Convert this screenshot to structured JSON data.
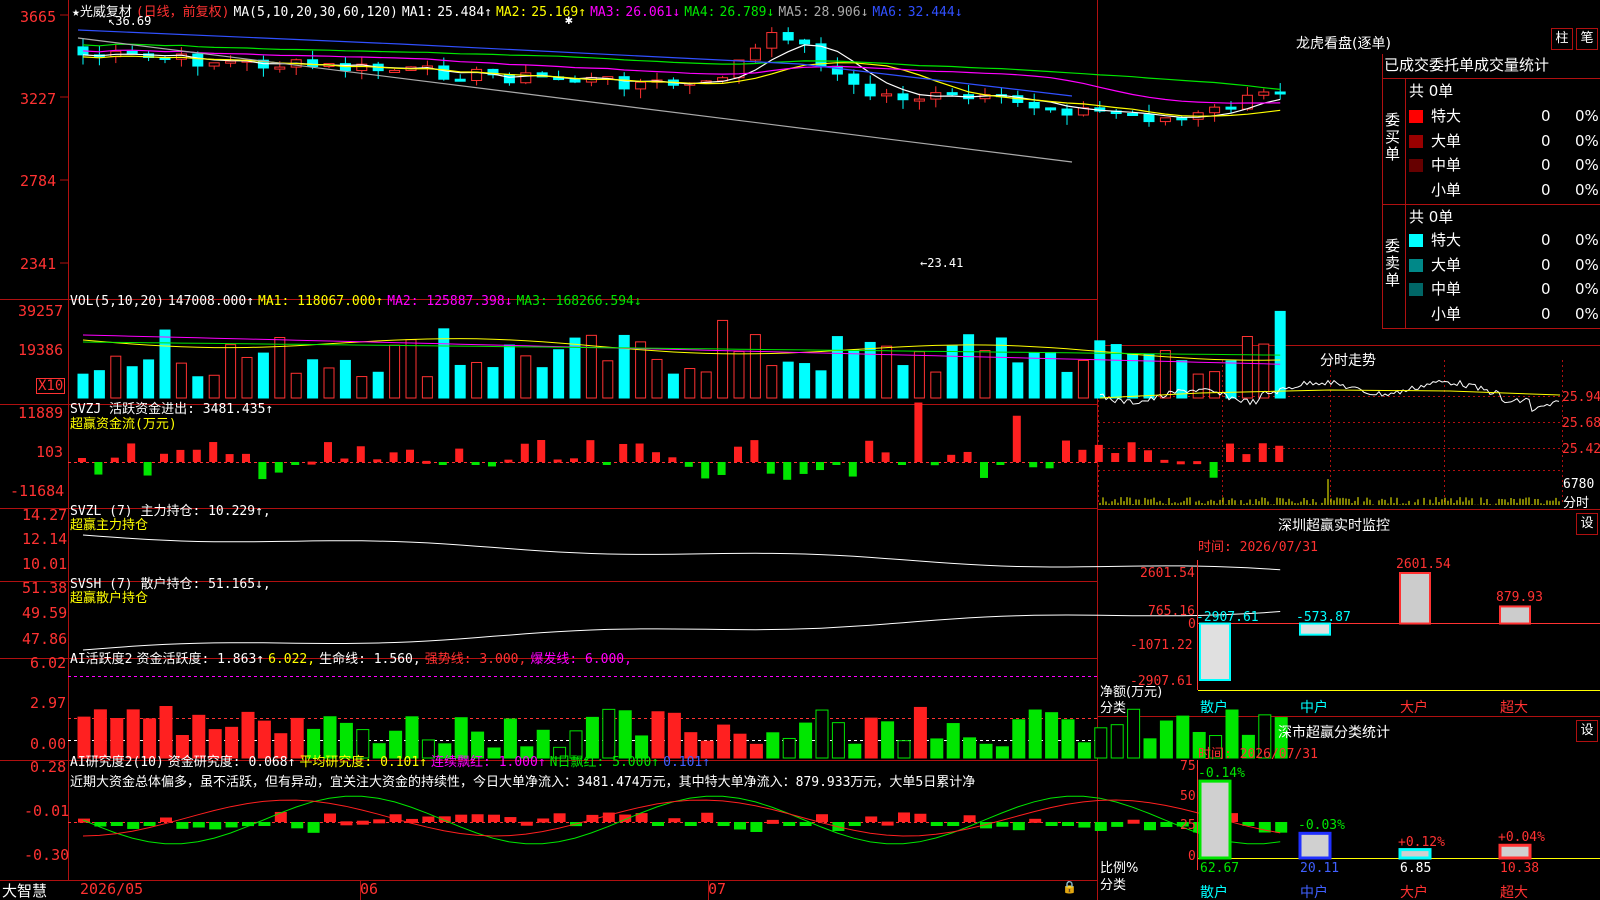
{
  "app": {
    "brand": "大智慧"
  },
  "main": {
    "star": "★",
    "stock": "光威复材",
    "period": "(日线，前复权)",
    "ma_header": "MA(5,10,20,30,60,120)",
    "ma": [
      {
        "label": "MA1:",
        "val": "25.484↑",
        "color": "#ffffff"
      },
      {
        "label": "MA2:",
        "val": "25.169↑",
        "color": "#ffff00"
      },
      {
        "label": "MA3:",
        "val": "26.061↓",
        "color": "#ff00ff"
      },
      {
        "label": "MA4:",
        "val": "26.789↓",
        "color": "#00e600"
      },
      {
        "label": "MA5:",
        "val": "28.906↓",
        "color": "#aaaaaa"
      },
      {
        "label": "MA6:",
        "val": "32.444↓",
        "color": "#3050ff"
      }
    ],
    "y_ticks": [
      "3665",
      "3227",
      "2784",
      "2341"
    ],
    "high_mark": "36.69",
    "low_mark": "←23.41",
    "snow": "✱"
  },
  "vol": {
    "header": "VOL(5,10,20)",
    "value": "147008.000↑",
    "ma1": "MA1: 118067.000↑",
    "ma2": "MA2: 125887.398↓",
    "ma3": "MA3: 168266.594↓",
    "y_ticks": [
      "39257",
      "19386"
    ],
    "unit": "X10"
  },
  "svzj": {
    "title": "SVZJ",
    "label": "活跃资金进出: 3481.435↑",
    "sub": "超赢资金流(万元)",
    "y_ticks": [
      "11889",
      "103",
      "-11684"
    ]
  },
  "svzl": {
    "title": "SVZL (7)",
    "label": "主力持仓: 10.229↑,",
    "sub": "超赢主力持仓",
    "y_ticks": [
      "14.27",
      "12.14",
      "10.01"
    ]
  },
  "svsh": {
    "title": "SVSH (7)",
    "label": "散户持仓: 51.165↓,",
    "sub": "超赢散户持仓",
    "y_ticks": [
      "51.38",
      "49.59",
      "47.86"
    ]
  },
  "ai1": {
    "title": "AI活跃度2",
    "parts": [
      {
        "t": "资金活跃度: 1.863↑",
        "c": "#ffffff"
      },
      {
        "t": "6.022,",
        "c": "#ffff00"
      },
      {
        "t": "生命线: 1.560,",
        "c": "#ffffff"
      },
      {
        "t": "强势线: 3.000,",
        "c": "#ff3232"
      },
      {
        "t": "爆发线: 6.000,",
        "c": "#ff00ff"
      }
    ],
    "y_ticks": [
      "6.02",
      "2.97",
      "0.00"
    ]
  },
  "ai2": {
    "title": "AI研究度2(10)",
    "parts": [
      {
        "t": "资金研究度: 0.068↑",
        "c": "#ffffff"
      },
      {
        "t": "平均研究度: 0.101↑",
        "c": "#ffff00"
      },
      {
        "t": "连续飘红: 1.000↑",
        "c": "#ff00ff"
      },
      {
        "t": "N日飘红: 5.000↑",
        "c": "#00e600"
      },
      {
        "t": "0.101↑",
        "c": "#4060ff"
      }
    ],
    "comment": "近期大资金总体偏多，虽不活跃，但有异动，宜关注大资金的持续性，今日大单净流入：3481.474万元，其中特大单净流入：879.933万元，大单5日累计净",
    "y_ticks": [
      "0.28",
      "-0.01",
      "-0.30"
    ]
  },
  "xaxis": [
    "2026/05",
    "06",
    "07"
  ],
  "right": {
    "lhb_title": "龙虎看盘(逐单)",
    "btn_zhu": "柱",
    "btn_bi": "笔",
    "stat_title": "已成交委托单成交量统计",
    "buy_label": "委买单",
    "sell_label": "委卖单",
    "buy_total": "共 0单",
    "sell_total": "共 0单",
    "buy_rows": [
      {
        "name": "特大",
        "n": "0",
        "p": "0%",
        "c": "#ff0000"
      },
      {
        "name": "大单",
        "n": "0",
        "p": "0%",
        "c": "#990000"
      },
      {
        "name": "中单",
        "n": "0",
        "p": "0%",
        "c": "#660000"
      },
      {
        "name": "小单",
        "n": "0",
        "p": "0%",
        "c": ""
      }
    ],
    "sell_rows": [
      {
        "name": "特大",
        "n": "0",
        "p": "0%",
        "c": "#00ffff"
      },
      {
        "name": "大单",
        "n": "0",
        "p": "0%",
        "c": "#008888"
      },
      {
        "name": "中单",
        "n": "0",
        "p": "0%",
        "c": "#006666"
      },
      {
        "name": "小单",
        "n": "0",
        "p": "0%",
        "c": ""
      }
    ],
    "intraday_title": "分时走势",
    "intraday_ticks": [
      "25.94",
      "25.68",
      "25.42"
    ],
    "intraday_vol": "6780",
    "intraday_vol_label": "分时",
    "sz_title": "深圳超赢实时监控",
    "sz_set": "设",
    "sz_time": "时间: 2026/07/31",
    "sz_ticks": [
      "2601.54",
      "765.16",
      "0",
      "-1071.22",
      "-2907.61"
    ],
    "sz_values": [
      {
        "cat": "散户",
        "v": -2907.61,
        "label": "-2907.61"
      },
      {
        "cat": "中户",
        "v": -573.87,
        "label": "-573.87"
      },
      {
        "cat": "大户",
        "v": 2601.54,
        "label": "2601.54"
      },
      {
        "cat": "超大",
        "v": 879.93,
        "label": "879.93"
      }
    ],
    "sz_ylabel": "净额(万元)",
    "sz_xlabel": "分类",
    "sc_title": "深市超赢分类统计",
    "sc_set": "设",
    "sc_time": "时间: 2026/07/31",
    "sc_ticks": [
      "75",
      "50",
      "25",
      "0"
    ],
    "sc_values": [
      {
        "cat": "散户",
        "v": 62.67,
        "label": "62.67",
        "chg": "-0.14%"
      },
      {
        "cat": "中户",
        "v": 20.11,
        "label": "20.11",
        "chg": "-0.03%"
      },
      {
        "cat": "大户",
        "v": 6.85,
        "label": "6.85",
        "chg": "+0.12%"
      },
      {
        "cat": "超大",
        "v": 10.38,
        "label": "10.38",
        "chg": "+0.04%"
      }
    ],
    "sc_ylabel": "比例%",
    "sc_xlabel": "分类"
  },
  "chart_data": [
    {
      "type": "bar",
      "title": "深圳超赢实时监控",
      "categories": [
        "散户",
        "中户",
        "大户",
        "超大"
      ],
      "values": [
        -2907.61,
        -573.87,
        2601.54,
        879.93
      ],
      "ylabel": "净额(万元)",
      "xlabel": "分类",
      "ylim": [
        -2907.61,
        2601.54
      ]
    },
    {
      "type": "bar",
      "title": "深市超赢分类统计",
      "categories": [
        "散户",
        "中户",
        "大户",
        "超大"
      ],
      "values": [
        62.67,
        20.11,
        6.85,
        10.38
      ],
      "ylabel": "比例%",
      "xlabel": "分类",
      "ylim": [
        0,
        75
      ]
    }
  ]
}
